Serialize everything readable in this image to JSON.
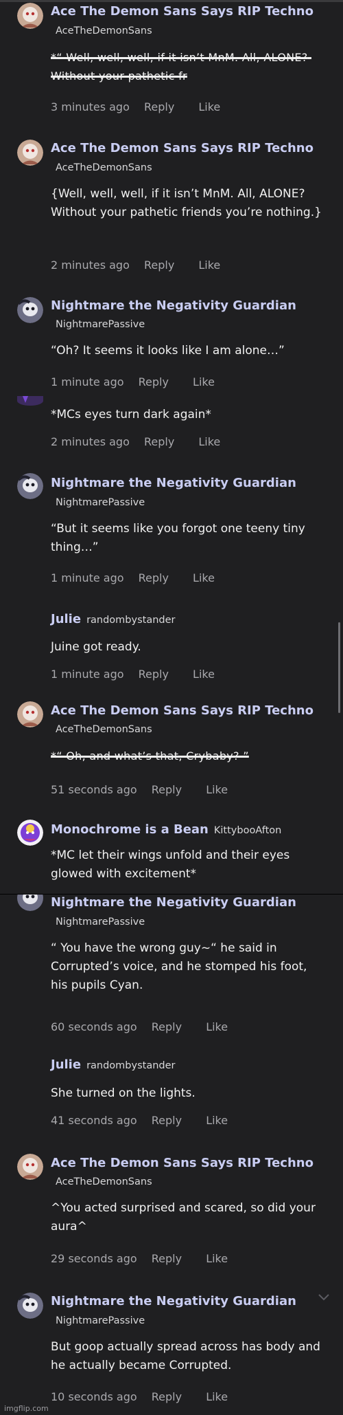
{
  "comments": [
    {
      "name": "Ace The Demon Sans Says RIP Techno",
      "handle": "AceTheDemonSans",
      "text": "*“ Well, well, well, if it isn’t MnM. All, ALONE? Without your pathetic fr",
      "time": "3 minutes ago",
      "reply": "Reply",
      "like": "Like"
    },
    {
      "name": "Ace The Demon Sans Says RIP Techno",
      "handle": "AceTheDemonSans",
      "text": "{Well, well, well, if it isn’t MnM. All, ALONE? Without your pathetic friends you’re nothing.}",
      "time": "2 minutes ago",
      "reply": "Reply",
      "like": "Like"
    },
    {
      "name": "Nightmare the Negativity Guardian",
      "handle": "NightmarePassive",
      "text": "“Oh? It seems it looks like I am alone…”",
      "time": "1 minute ago",
      "reply": "Reply",
      "like": "Like"
    },
    {
      "text": "*MCs eyes turn dark again*",
      "time": "2 minutes ago",
      "reply": "Reply",
      "like": "Like"
    },
    {
      "name": "Nightmare the Negativity Guardian",
      "handle": "NightmarePassive",
      "text": "“But it seems like you forgot one teeny tiny thing…”",
      "time": "1 minute ago",
      "reply": "Reply",
      "like": "Like"
    },
    {
      "name": "Julie",
      "handle": "randombystander",
      "text": "Juine got ready.",
      "time": "1 minute ago",
      "reply": "Reply",
      "like": "Like"
    },
    {
      "name": "Ace The Demon Sans Says RIP Techno",
      "handle": "AceTheDemonSans",
      "text": "*“ Oh, and what’s that, Crybaby? ”",
      "time": "51 seconds ago",
      "reply": "Reply",
      "like": "Like"
    },
    {
      "name": "Monochrome is a Bean",
      "handle": "KittybooAfton",
      "text": "*MC let their wings unfold and their eyes glowed with excitement*"
    },
    {
      "name": "Nightmare the Negativity Guardian",
      "handle": "NightmarePassive",
      "text": "“ You have the wrong guy~“ he said in Corrupted’s voice, and he stomped his foot, his pupils Cyan.",
      "time": "60 seconds ago",
      "reply": "Reply",
      "like": "Like"
    },
    {
      "name": "Julie",
      "handle": "randombystander",
      "text": "She turned on the lights.",
      "time": "41 seconds ago",
      "reply": "Reply",
      "like": "Like"
    },
    {
      "name": "Ace The Demon Sans Says RIP Techno",
      "handle": "AceTheDemonSans",
      "text": "^You acted surprised and scared, so did your aura^",
      "time": "29 seconds ago",
      "reply": "Reply",
      "like": "Like"
    },
    {
      "name": "Nightmare the Negativity Guardian",
      "handle": "NightmarePassive",
      "text": "But goop actually spread across has body and he actually became Corrupted.",
      "time": "10 seconds ago",
      "reply": "Reply",
      "like": "Like"
    }
  ],
  "watermark": "imgflip.com",
  "colors": {
    "background": "#1f1f21",
    "name": "#c9cdf2",
    "meta": "#a9a9ad",
    "text": "#f1f1f1"
  },
  "icons": {
    "avatar_ace": "ace-avatar-icon",
    "avatar_nightmare": "nightmare-avatar-icon",
    "avatar_mono": "monochrome-avatar-icon",
    "chevron": "chevron-down-icon"
  }
}
